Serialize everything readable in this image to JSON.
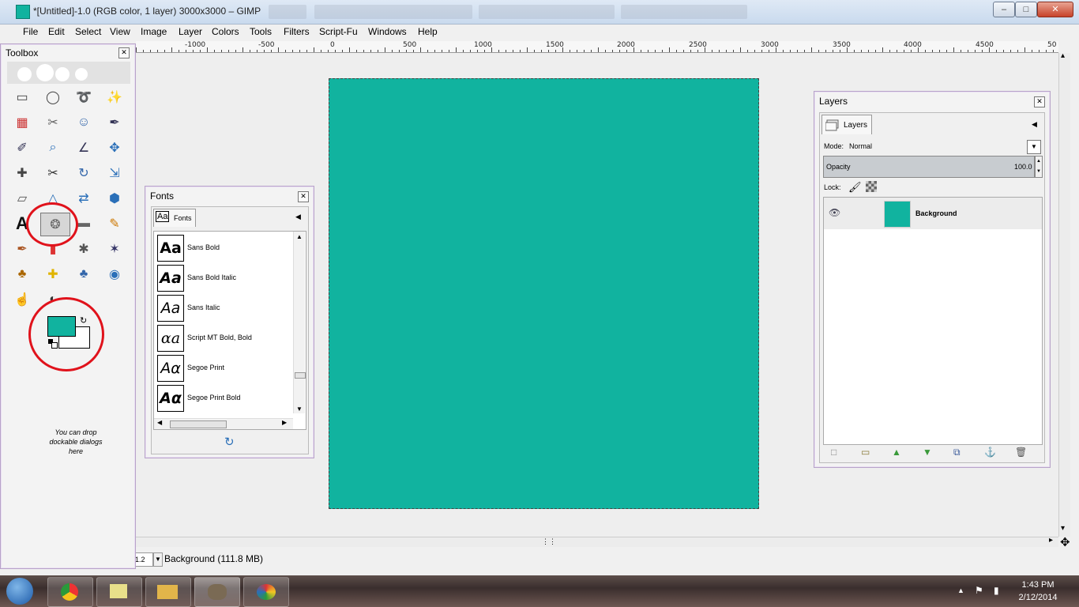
{
  "window": {
    "title": "*[Untitled]-1.0 (RGB color, 1 layer) 3000x3000 – GIMP",
    "minimize": "–",
    "maximize": "□",
    "close": "✕"
  },
  "menu": [
    "File",
    "Edit",
    "Select",
    "View",
    "Image",
    "Layer",
    "Colors",
    "Tools",
    "Filters",
    "Script-Fu",
    "Windows",
    "Help"
  ],
  "ruler": {
    "labels": [
      "-1000",
      "-500",
      "0",
      "500",
      "1000",
      "1500",
      "2000",
      "2500",
      "3000",
      "3500",
      "4000",
      "4500",
      "50"
    ]
  },
  "canvas": {
    "image_color": "#11b39f"
  },
  "statusbar": {
    "zoom": "1.2 %",
    "info": "Background (111.8 MB)"
  },
  "toolbox": {
    "title": "Toolbox",
    "close": "✕",
    "fg_color": "#11b39f",
    "bg_color": "#ffffff",
    "drop_hint": "You can drop dockable dialogs here",
    "tools": [
      "rect-select-icon",
      "ellipse-select-icon",
      "lasso-icon",
      "fuzzy-select-icon",
      "color-select-icon",
      "scissors-icon",
      "foreground-select-icon",
      "paths-icon",
      "color-picker-icon",
      "zoom-icon",
      "measure-icon",
      "move-icon",
      "align-icon",
      "crop-icon",
      "rotate-icon",
      "scale-icon",
      "shear-icon",
      "perspective-icon",
      "flip-icon",
      "cage-icon",
      "text-icon",
      "bucket-fill-icon",
      "blend-icon",
      "pencil-icon",
      "paintbrush-icon",
      "eraser-icon",
      "airbrush-icon",
      "ink-icon",
      "clone-icon",
      "heal-icon",
      "perspective-clone-icon",
      "blur-icon",
      "smudge-icon",
      "dodge-burn-icon"
    ]
  },
  "fonts": {
    "title": "Fonts",
    "close": "✕",
    "tab": "Fonts",
    "tab_icon": "Aa",
    "items": [
      {
        "preview": "Aa",
        "name": "Sans Bold"
      },
      {
        "preview": "Aa",
        "name": "Sans Bold Italic"
      },
      {
        "preview": "Aa",
        "name": "Sans Italic"
      },
      {
        "preview": "ɑa",
        "name": "Script MT Bold, Bold"
      },
      {
        "preview": "Aα",
        "name": "Segoe Print"
      },
      {
        "preview": "Aα",
        "name": "Segoe Print Bold"
      }
    ]
  },
  "layers": {
    "title": "Layers",
    "close": "✕",
    "tab": "Layers",
    "mode_label": "Mode:",
    "mode_value": "Normal",
    "opacity_label": "Opacity",
    "opacity_value": "100.0",
    "lock_label": "Lock:",
    "layer_name": "Background",
    "layer_color": "#11b39f"
  },
  "taskbar": {
    "time": "1:43 PM",
    "date": "2/12/2014",
    "apps": [
      "start-orb-icon",
      "chrome-icon",
      "sticky-notes-icon",
      "explorer-icon",
      "gimp-icon",
      "paint-icon"
    ]
  }
}
